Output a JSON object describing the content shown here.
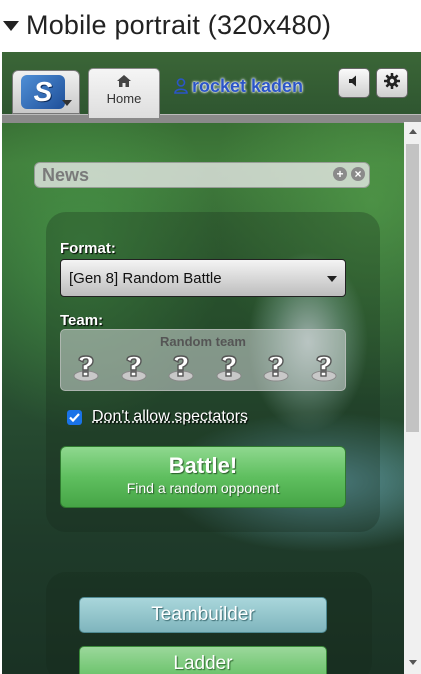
{
  "section": {
    "title": "Mobile portrait (320x480)"
  },
  "header": {
    "home_tab": "Home",
    "username": "rocket kaden"
  },
  "news": {
    "label": "News"
  },
  "battle_form": {
    "format_label": "Format:",
    "format_value": "[Gen 8] Random Battle",
    "team_label": "Team:",
    "team_caption": "Random team",
    "team_slots": 6,
    "spectators_label": "Don't allow spectators",
    "spectators_checked": true,
    "battle_label": "Battle!",
    "battle_sublabel": "Find a random opponent"
  },
  "menu": {
    "teambuilder": "Teambuilder",
    "ladder": "Ladder"
  },
  "icons": {
    "logo": "showdown-logo-icon",
    "home": "home-icon",
    "user": "user-icon",
    "sound": "speaker-icon",
    "settings": "gear-icon"
  },
  "colors": {
    "username": "#2b55c7",
    "battle_button": "#5fbf5f",
    "teambuilder_button": "#7fb5bd",
    "ladder_button": "#63bf63"
  }
}
